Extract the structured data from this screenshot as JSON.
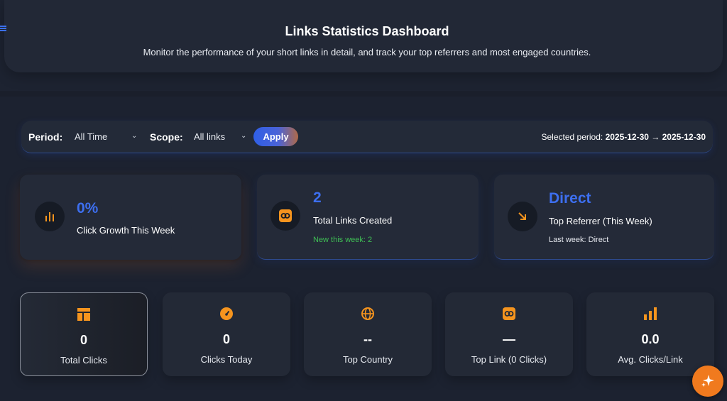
{
  "header": {
    "title": "Links Statistics Dashboard",
    "subtitle": "Monitor the performance of your short links in detail, and track your top referrers and most engaged countries."
  },
  "filters": {
    "period_label": "Period:",
    "period_value": "All Time",
    "scope_label": "Scope:",
    "scope_value": "All links",
    "apply_label": "Apply",
    "selected_period_label": "Selected period:",
    "selected_period_value": "2025-12-30 → 2025-12-30"
  },
  "top_cards": [
    {
      "value": "0%",
      "label": "Click Growth This Week",
      "icon": "bar-chart-icon"
    },
    {
      "value": "2",
      "label": "Total Links Created",
      "sub": "New this week: 2",
      "icon": "link-icon"
    },
    {
      "value": "Direct",
      "label": "Top Referrer (This Week)",
      "sub": "Last week: Direct",
      "icon": "arrow-down-right-icon"
    }
  ],
  "stats": [
    {
      "value": "0",
      "label": "Total Clicks",
      "icon": "layout-icon"
    },
    {
      "value": "0",
      "label": "Clicks Today",
      "icon": "gauge-icon"
    },
    {
      "value": "--",
      "label": "Top Country",
      "icon": "globe-icon"
    },
    {
      "value": "—",
      "label": "Top Link (0 Clicks)",
      "icon": "link-icon"
    },
    {
      "value": "0.0",
      "label": "Avg. Clicks/Link",
      "icon": "bar-chart-icon"
    }
  ],
  "colors": {
    "accent_blue": "#3d6ff0",
    "accent_orange": "#f5941e",
    "positive_green": "#3fbf55",
    "background": "#1c2230"
  },
  "fab_icon": "sparkles-icon"
}
